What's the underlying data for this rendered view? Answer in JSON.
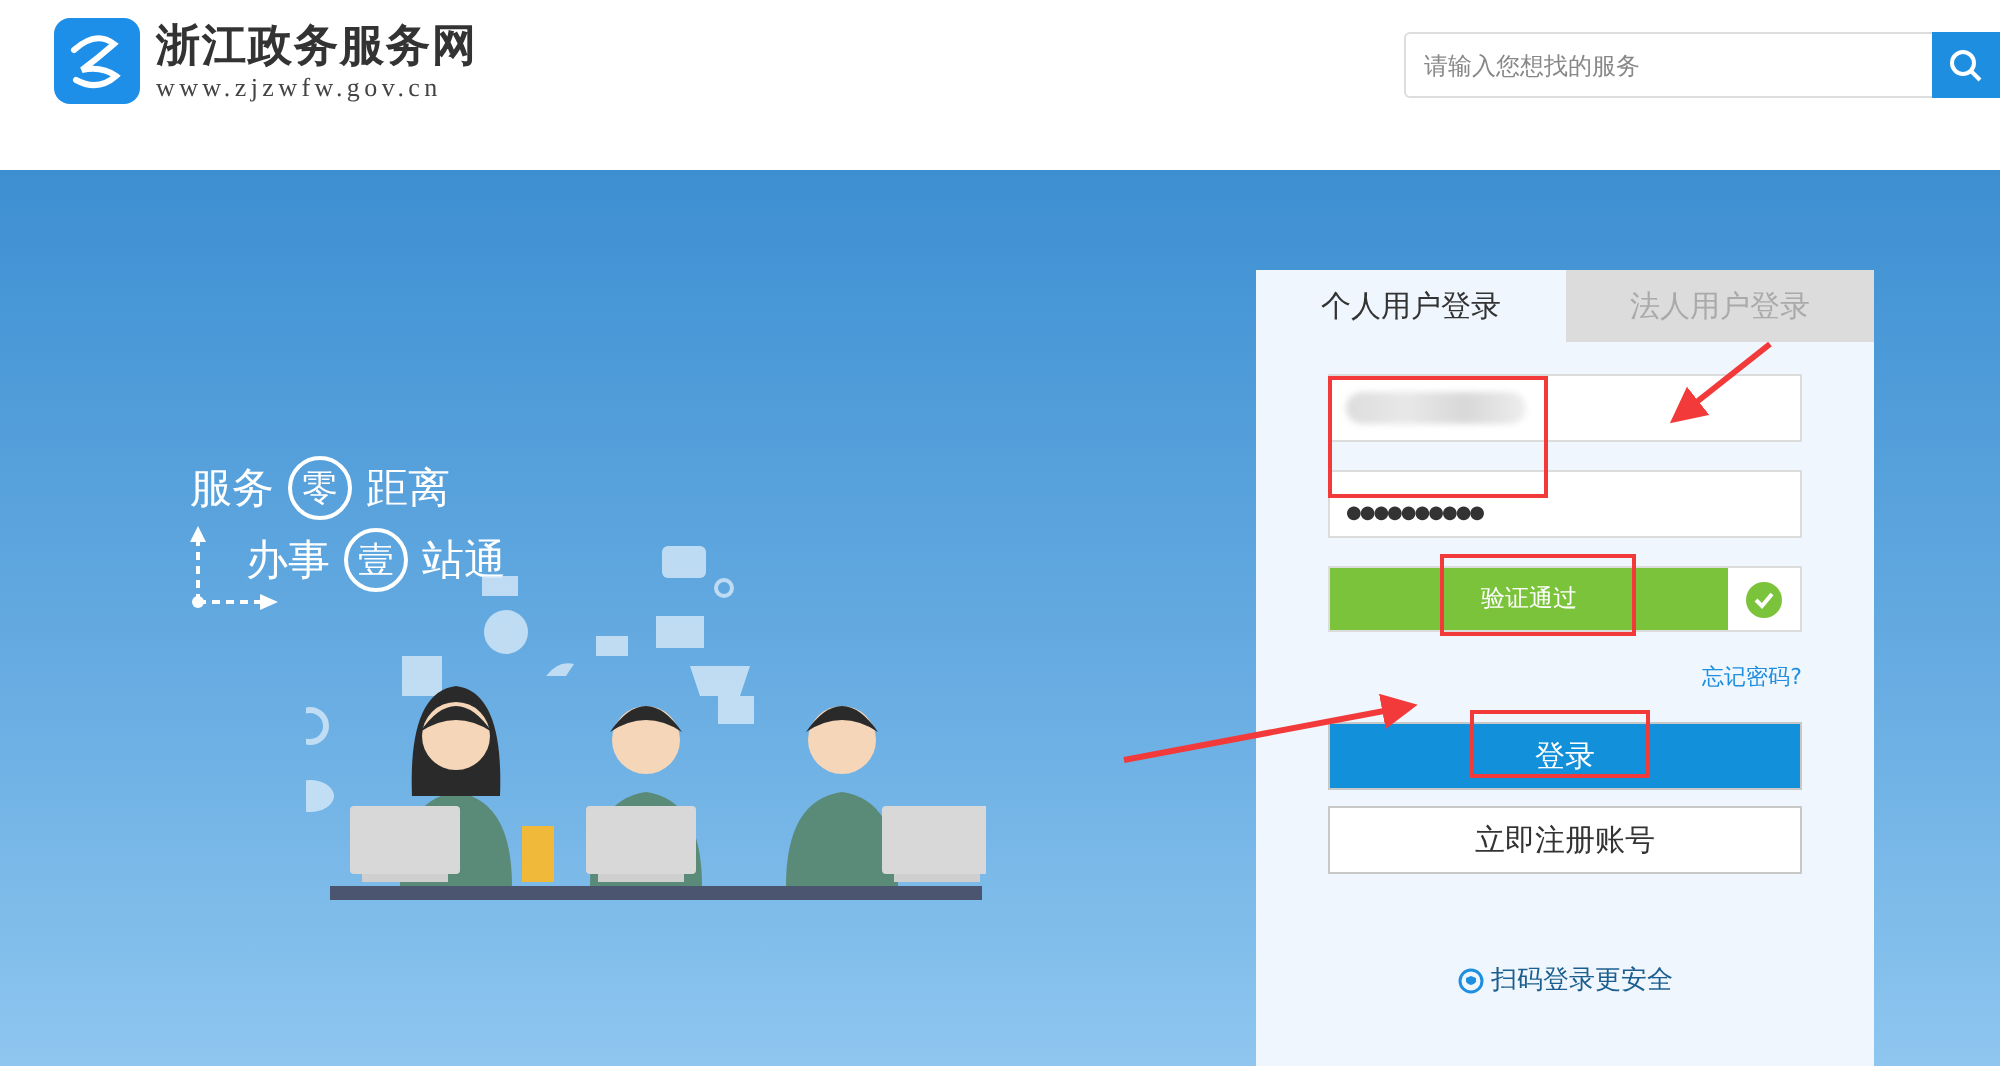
{
  "header": {
    "site_name": "浙江政务服务网",
    "site_url": "www.zjzwfw.gov.cn",
    "search": {
      "placeholder": "请输入您想找的服务"
    }
  },
  "slogan": [
    {
      "before": "服务",
      "circled": "零",
      "after": "距离"
    },
    {
      "before": "办事",
      "circled": "壹",
      "after": "站通"
    }
  ],
  "login": {
    "tabs": [
      {
        "label": "个人用户登录",
        "selected": true
      },
      {
        "label": "法人用户登录",
        "selected": false
      }
    ],
    "password": {
      "value": "●●●●●●●●●●"
    },
    "verify": {
      "label": "验证通过",
      "verified": true
    },
    "forgot_link": "忘记密码?",
    "login_button": "登录",
    "register_button": "立即注册账号",
    "qr_link": "扫码登录更安全"
  }
}
